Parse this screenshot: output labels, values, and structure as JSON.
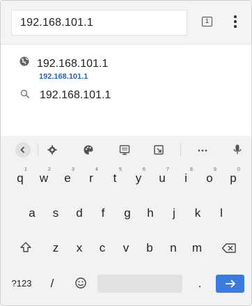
{
  "address_bar": {
    "url_text": "192.168.101.1",
    "tab_count": "1"
  },
  "suggestions": {
    "item1": {
      "title": "192.168.101.1",
      "url": "192.168.101.1"
    },
    "item2": {
      "title": "192.168.101.1"
    }
  },
  "keyboard": {
    "row1": [
      {
        "key": "q",
        "hint": "1"
      },
      {
        "key": "w",
        "hint": "2"
      },
      {
        "key": "e",
        "hint": "3"
      },
      {
        "key": "r",
        "hint": "4"
      },
      {
        "key": "t",
        "hint": "5"
      },
      {
        "key": "y",
        "hint": "6"
      },
      {
        "key": "u",
        "hint": "7"
      },
      {
        "key": "i",
        "hint": "8"
      },
      {
        "key": "o",
        "hint": "9"
      },
      {
        "key": "p",
        "hint": "0"
      }
    ],
    "row2": [
      "a",
      "s",
      "d",
      "f",
      "g",
      "h",
      "j",
      "k",
      "l"
    ],
    "row3": [
      "z",
      "x",
      "c",
      "v",
      "b",
      "n",
      "m"
    ],
    "symbols_label": "?123",
    "slash_label": "/",
    "period_label": ".",
    "toolbar_icons": [
      "back-icon",
      "settings-icon",
      "palette-icon",
      "clipboard-icon",
      "screenshot-icon",
      "more-icon",
      "mic-icon"
    ],
    "accent_color": "#3b7be0"
  }
}
